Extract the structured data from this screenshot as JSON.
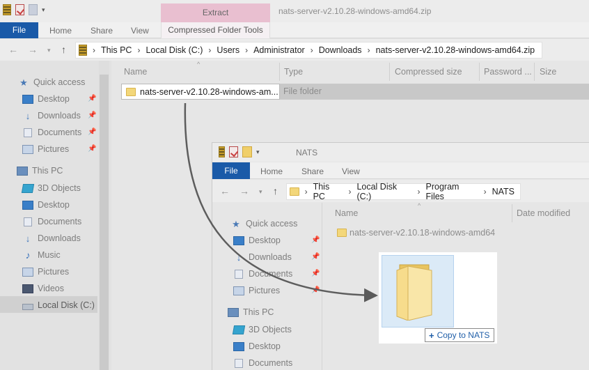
{
  "back_window": {
    "title": "nats-server-v2.10.28-windows-amd64.zip",
    "context_tab": "Extract",
    "tabs": {
      "file": "File",
      "home": "Home",
      "share": "Share",
      "view": "View",
      "context": "Compressed Folder Tools"
    },
    "breadcrumb": [
      "This PC",
      "Local Disk (C:)",
      "Users",
      "Administrator",
      "Downloads",
      "nats-server-v2.10.28-windows-amd64.zip"
    ],
    "sidebar": {
      "quick_access": "Quick access",
      "desktop": "Desktop",
      "downloads": "Downloads",
      "documents": "Documents",
      "pictures": "Pictures",
      "this_pc": "This PC",
      "objects_3d": "3D Objects",
      "desktop2": "Desktop",
      "documents2": "Documents",
      "downloads2": "Downloads",
      "music": "Music",
      "pictures2": "Pictures",
      "videos": "Videos",
      "local_disk": "Local Disk (C:)"
    },
    "columns": {
      "name": "Name",
      "type": "Type",
      "compressed_size": "Compressed size",
      "password": "Password ...",
      "size": "Size"
    },
    "row": {
      "name": "nats-server-v2.10.28-windows-am...",
      "type": "File folder"
    }
  },
  "front_window": {
    "title": "NATS",
    "tabs": {
      "file": "File",
      "home": "Home",
      "share": "Share",
      "view": "View"
    },
    "breadcrumb": [
      "This PC",
      "Local Disk (C:)",
      "Program Files",
      "NATS"
    ],
    "sidebar": {
      "quick_access": "Quick access",
      "desktop": "Desktop",
      "downloads": "Downloads",
      "documents": "Documents",
      "pictures": "Pictures",
      "this_pc": "This PC",
      "objects_3d": "3D Objects",
      "desktop2": "Desktop",
      "documents2": "Documents"
    },
    "columns": {
      "name": "Name",
      "date_modified": "Date modified"
    },
    "row": {
      "name": "nats-server-v2.10.18-windows-amd64"
    }
  },
  "drag": {
    "tooltip": "Copy to NATS",
    "tooltip_icon": "plus-icon",
    "preview_icon": "folder-icon"
  }
}
